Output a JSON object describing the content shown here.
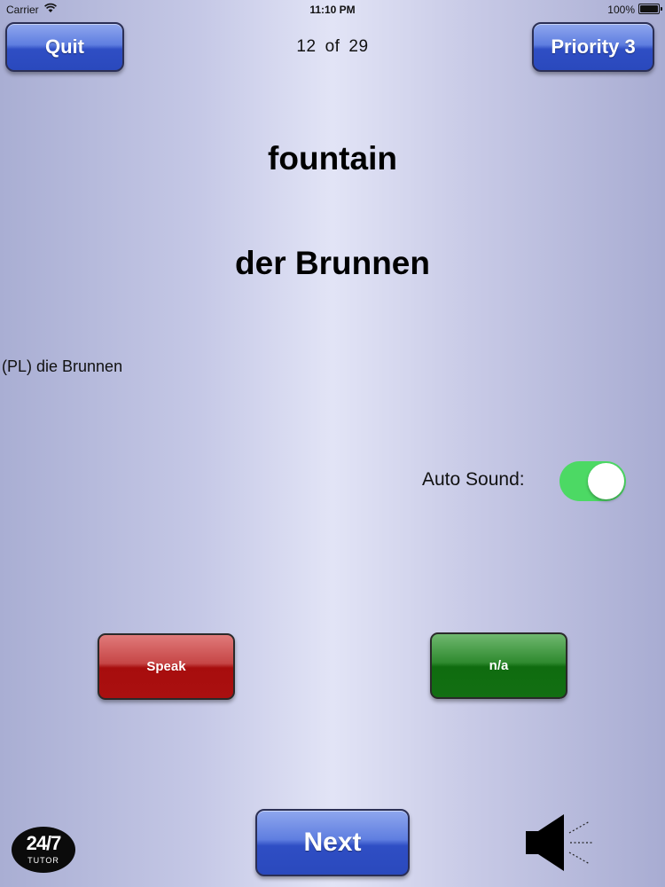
{
  "status_bar": {
    "carrier": "Carrier",
    "time": "11:10 PM",
    "battery": "100%"
  },
  "header": {
    "quit_label": "Quit",
    "counter": {
      "current": "12",
      "separator": "of",
      "total": "29"
    },
    "priority_label": "Priority 3"
  },
  "card": {
    "english": "fountain",
    "german": "der Brunnen",
    "plural": "(PL) die Brunnen"
  },
  "auto_sound": {
    "label": "Auto Sound:",
    "enabled": true
  },
  "actions": {
    "speak_label": "Speak",
    "na_label": "n/a"
  },
  "footer": {
    "next_label": "Next",
    "logo": {
      "main": "24/7",
      "sub": "TUTOR"
    },
    "speaker_icon": "speaker-icon"
  },
  "colors": {
    "toggle_on": "#4cd964",
    "speak_red": "#a70d0d",
    "na_green": "#0f6c0f",
    "button_blue": "#2f4ec4"
  }
}
